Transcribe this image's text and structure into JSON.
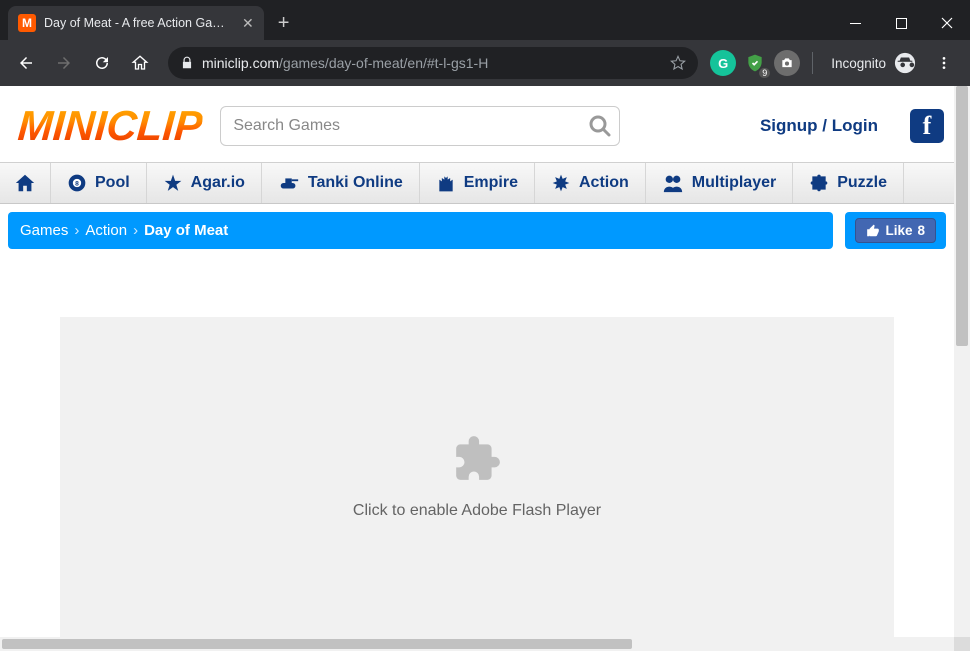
{
  "browser": {
    "tab_title": "Day of Meat - A free Action Gam…",
    "tab_favicon_letter": "M",
    "url_domain": "miniclip.com",
    "url_path": "/games/day-of-meat/en/#t-l-gs1-H",
    "incognito_label": "Incognito",
    "ext_badge": "9"
  },
  "header": {
    "logo_text": "MINICLIP",
    "search_placeholder": "Search Games",
    "auth_text": "Signup / Login",
    "facebook_letter": "f"
  },
  "nav": {
    "pool": "Pool",
    "agar": "Agar.io",
    "tanki": "Tanki Online",
    "empire": "Empire",
    "action": "Action",
    "multiplayer": "Multiplayer",
    "puzzle": "Puzzle"
  },
  "breadcrumb": {
    "games": "Games",
    "action": "Action",
    "current": "Day of Meat",
    "sep": "›"
  },
  "like": {
    "label": "Like",
    "count": "8"
  },
  "flash": {
    "message": "Click to enable Adobe Flash Player"
  }
}
